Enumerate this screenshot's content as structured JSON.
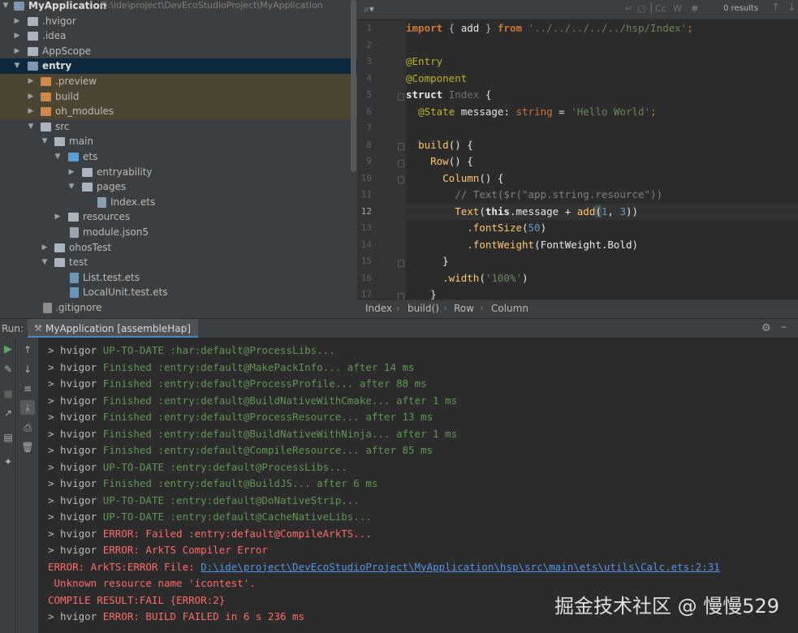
{
  "project_tree": {
    "root": {
      "name": "MyApplication",
      "path": "D:\\ide\\project\\DevEcoStudioProject\\MyApplication"
    },
    "items": [
      {
        "label": "MyApplication"
      },
      {
        "label": ".hvigor"
      },
      {
        "label": ".idea"
      },
      {
        "label": "AppScope"
      },
      {
        "label": "entry"
      },
      {
        "label": ".preview"
      },
      {
        "label": "build"
      },
      {
        "label": "oh_modules"
      },
      {
        "label": "src"
      },
      {
        "label": "main"
      },
      {
        "label": "ets"
      },
      {
        "label": "entryability"
      },
      {
        "label": "pages"
      },
      {
        "label": "Index.ets"
      },
      {
        "label": "resources"
      },
      {
        "label": "module.json5"
      },
      {
        "label": "ohosTest"
      },
      {
        "label": "test"
      },
      {
        "label": "List.test.ets"
      },
      {
        "label": "LocalUnit.test.ets"
      },
      {
        "label": ".gitignore"
      }
    ]
  },
  "editor": {
    "search": {
      "results": "0 results",
      "case_toggle": "Cc",
      "word_toggle": "W"
    },
    "line_numbers": [
      "1",
      "2",
      "3",
      "4",
      "5",
      "6",
      "7",
      "8",
      "9",
      "10",
      "11",
      "12",
      "13",
      "14",
      "15",
      "16",
      "17"
    ],
    "current_line": "12",
    "code": {
      "l1": {
        "import": "import",
        "open": " { ",
        "name": "add",
        "close": " } ",
        "from": "from",
        "sp": " ",
        "path": "'../../../../../hsp/Index'",
        "end": ";"
      },
      "l3": {
        "ann": "@Entry"
      },
      "l4": {
        "ann": "@Component"
      },
      "l5": {
        "kw": "struct",
        "sp": " ",
        "cls": "Index",
        "rest": " {"
      },
      "l6": {
        "indent": "  ",
        "ann": "@State",
        "name": " message",
        "colon": ": ",
        "type": "string",
        "eq": " = ",
        "str": "'Hello World'",
        "end": ";"
      },
      "l8": {
        "indent": "  ",
        "fn": "build",
        "rest": "() {"
      },
      "l9": {
        "indent": "    ",
        "fn": "Row",
        "rest": "() {"
      },
      "l10": {
        "indent": "      ",
        "fn": "Column",
        "rest": "() {"
      },
      "l11": {
        "indent": "        ",
        "comment": "// Text($r(\"app.string.resource\"))"
      },
      "l12": {
        "indent": "        ",
        "fn": "Text",
        "open": "(",
        "this": "this",
        "prop": ".message",
        "plus": " + ",
        "fn2": "add",
        "p": "(",
        "n1": "1",
        "comma": ", ",
        "n2": "3",
        "close": "))"
      },
      "l13": {
        "indent": "          ",
        "fn": ".fontSize",
        "open": "(",
        "num": "50",
        "close": ")"
      },
      "l14": {
        "indent": "          ",
        "fn": ".fontWeight",
        "rest": "(FontWeight.",
        "enum": "Bold",
        "close": ")"
      },
      "l15": {
        "indent": "      ",
        "rest": "}"
      },
      "l16": {
        "indent": "      ",
        "fn": ".width",
        "open": "(",
        "str": "'100%'",
        "close": ")"
      },
      "l17": {
        "indent": "    ",
        "rest": "}"
      }
    },
    "breadcrumb": [
      "Index",
      "build()",
      "Row",
      "Column"
    ]
  },
  "run_panel": {
    "label": "Run:",
    "tab": "MyApplication [assembleHap]",
    "close": "×",
    "lines": [
      {
        "prefix": "> hvigor ",
        "status": "UP-TO-DATE",
        "task": " :har:default@ProcessLibs...",
        "after": ""
      },
      {
        "prefix": "> hvigor ",
        "status": "Finished",
        "task": " :entry:default@MakePackInfo...",
        "after": " after 14 ms"
      },
      {
        "prefix": "> hvigor ",
        "status": "Finished",
        "task": " :entry:default@ProcessProfile...",
        "after": " after 88 ms"
      },
      {
        "prefix": "> hvigor ",
        "status": "Finished",
        "task": " :entry:default@BuildNativeWithCmake...",
        "after": " after 1 ms"
      },
      {
        "prefix": "> hvigor ",
        "status": "Finished",
        "task": " :entry:default@ProcessResource...",
        "after": " after 13 ms"
      },
      {
        "prefix": "> hvigor ",
        "status": "Finished",
        "task": " :entry:default@BuildNativeWithNinja...",
        "after": " after 1 ms"
      },
      {
        "prefix": "> hvigor ",
        "status": "Finished",
        "task": " :entry:default@CompileResource...",
        "after": " after 85 ms"
      },
      {
        "prefix": "> hvigor ",
        "status": "UP-TO-DATE",
        "task": " :entry:default@ProcessLibs...",
        "after": ""
      },
      {
        "prefix": "> hvigor ",
        "status": "Finished",
        "task": " :entry:default@BuildJS...",
        "after": " after 6 ms"
      },
      {
        "prefix": "> hvigor ",
        "status": "UP-TO-DATE",
        "task": " :entry:default@DoNativeStrip...",
        "after": ""
      },
      {
        "prefix": "> hvigor ",
        "status": "UP-TO-DATE",
        "task": " :entry:default@CacheNativeLibs...",
        "after": ""
      }
    ],
    "error_lines": {
      "e1": {
        "prefix": "> hvigor ",
        "text": "ERROR: Failed :entry:default@CompileArkTS..."
      },
      "e2": {
        "prefix": "> hvigor ",
        "text": "ERROR: ArkTS Compiler Error"
      },
      "e3": {
        "text": "ERROR: ArkTS:ERROR File: ",
        "link": "D:\\ide\\project\\DevEcoStudioProject\\MyApplication\\hsp\\src\\main\\ets\\utils\\Calc.ets:2:31"
      },
      "e4": {
        "text": " Unknown resource name 'icontest'."
      },
      "e5": {
        "text": "COMPILE RESULT:FAIL {ERROR:2}"
      },
      "e6": {
        "prefix": "> hvigor ",
        "text": "ERROR: BUILD FAILED in 6 s 236 ms"
      }
    }
  },
  "watermark": "掘金技术社区 @ 慢慢529",
  "colors": {
    "accent": "#4a88c7",
    "error": "#ff6b68",
    "success": "#629755",
    "link": "#5394ec"
  }
}
